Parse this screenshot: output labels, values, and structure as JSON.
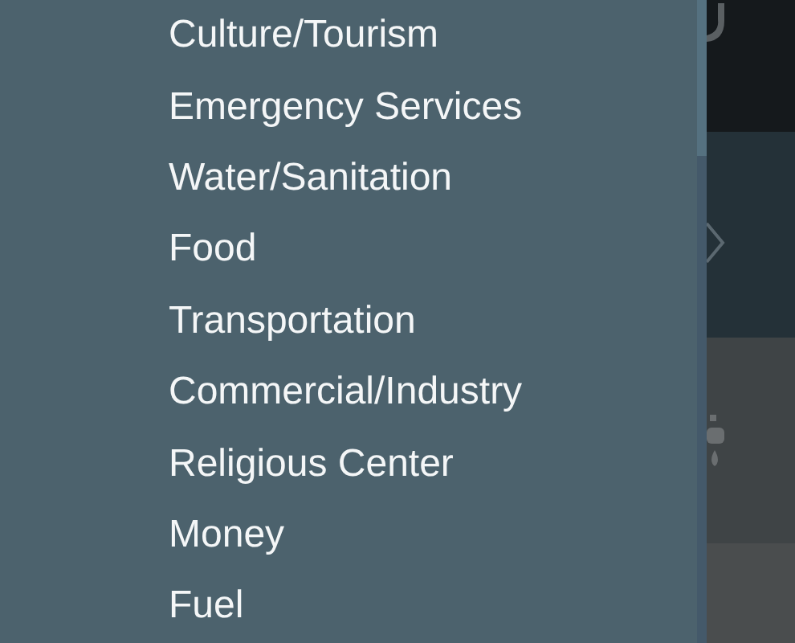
{
  "menu": {
    "items": [
      {
        "label": "Culture/Tourism"
      },
      {
        "label": "Emergency Services"
      },
      {
        "label": "Water/Sanitation"
      },
      {
        "label": "Food"
      },
      {
        "label": "Transportation"
      },
      {
        "label": "Commercial/Industry"
      },
      {
        "label": "Religious Center"
      },
      {
        "label": "Money"
      },
      {
        "label": "Fuel"
      }
    ]
  }
}
